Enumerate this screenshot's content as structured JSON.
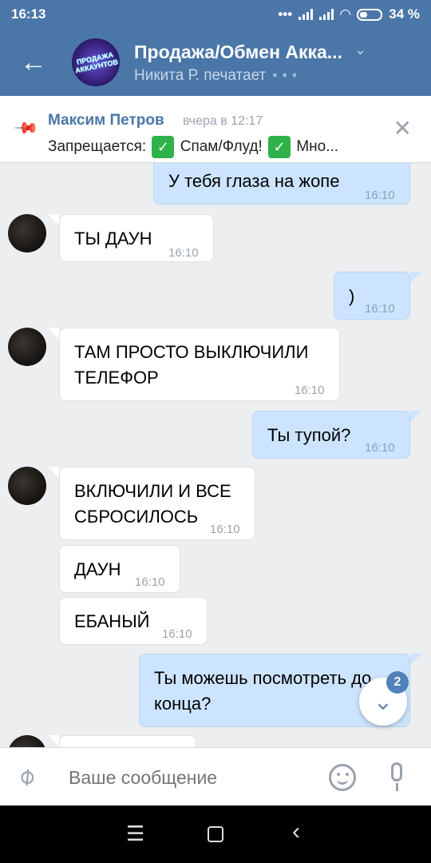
{
  "status": {
    "time": "16:13",
    "battery": "34 %"
  },
  "header": {
    "back_icon": "arrow-left-icon",
    "title": "Продажа/Обмен Акка...",
    "avatar_text": "ПРОДАЖА АККАУНТОВ",
    "typing": "Никита Р. печатает",
    "color": "#4a76a8"
  },
  "pinned": {
    "author": "Максим Петров",
    "time": "вчера в 12:17",
    "prefix": "Запрещается:",
    "item1": "Спам/Флуд!",
    "item2": "Мно...",
    "check": "✓"
  },
  "messages": [
    {
      "dir": "out",
      "text": "У тебя глаза на жопе",
      "time": "16:10"
    },
    {
      "dir": "in",
      "text": "ТЫ ДАУН",
      "time": "16:10"
    },
    {
      "dir": "out",
      "text": ")",
      "time": "16:10"
    },
    {
      "dir": "in",
      "text": "ТАМ ПРОСТО ВЫКЛЮЧИЛИ",
      "text2": "ТЕЛЕФОР",
      "time": "16:10"
    },
    {
      "dir": "out",
      "text": "Ты тупой?",
      "time": "16:10"
    },
    {
      "dir": "in",
      "text": "ВКЛЮЧИЛИ И ВСЕ",
      "text2": "СБРОСИЛОСЬ",
      "time": "16:10"
    },
    {
      "dir": "in",
      "text": "ДАУН",
      "time": "16:10"
    },
    {
      "dir": "in",
      "text": "ЕБАНЫЙ",
      "time": "16:10"
    },
    {
      "dir": "out",
      "text": "Ты можешь посмотреть до",
      "text2": "конца?"
    }
  ],
  "scroll": {
    "badge": "2"
  },
  "input": {
    "placeholder": "Ваше сообщение"
  }
}
